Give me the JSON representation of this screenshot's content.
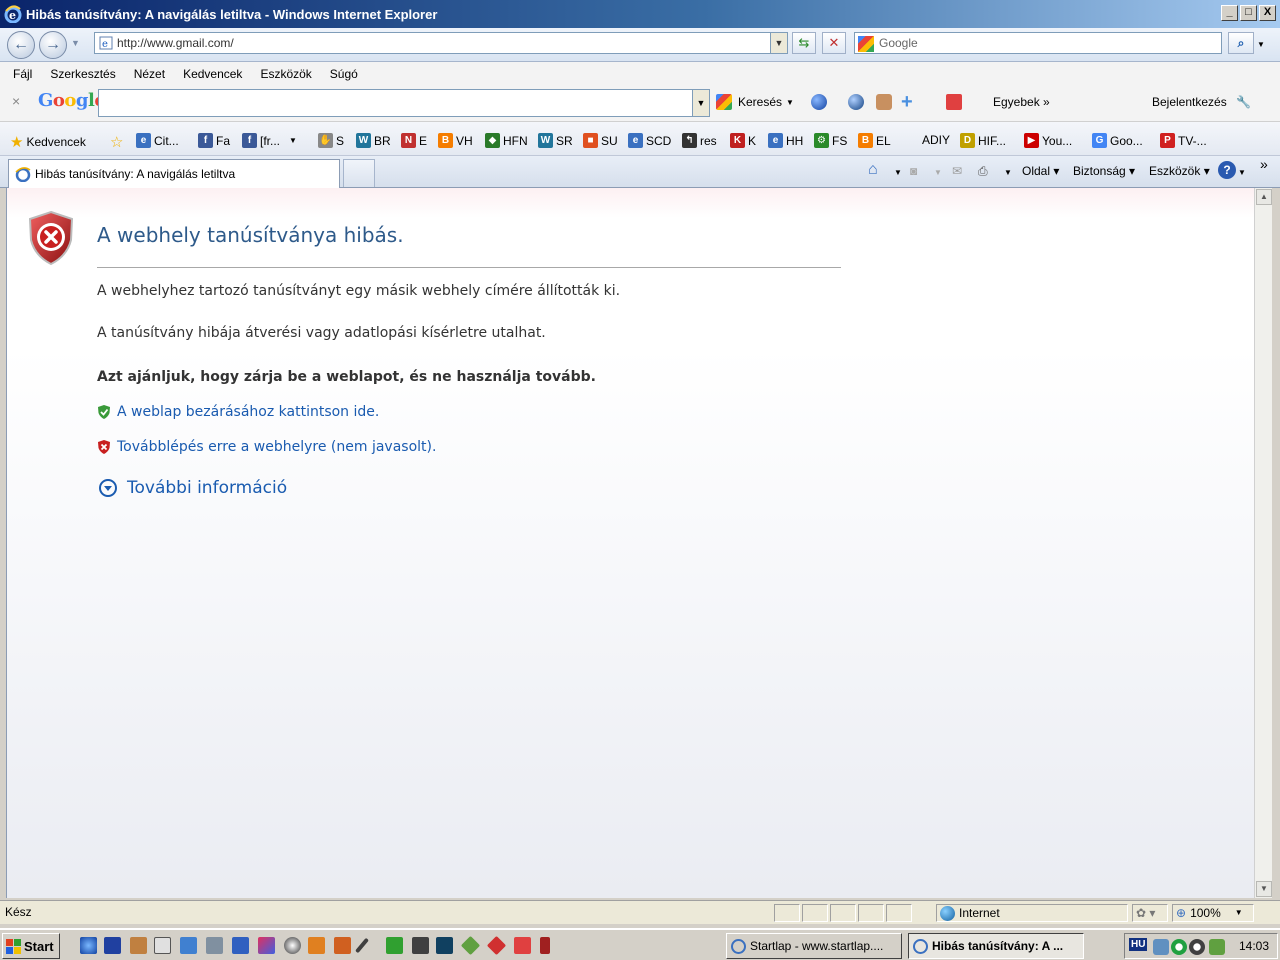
{
  "window": {
    "title": "Hibás tanúsítvány: A navigálás letiltva - Windows Internet Explorer",
    "buttons": {
      "minimize": "_",
      "maximize": "□",
      "close": "X"
    }
  },
  "navbar": {
    "address": "http://www.gmail.com/",
    "search_placeholder": "Google"
  },
  "menu": [
    "Fájl",
    "Szerkesztés",
    "Nézet",
    "Kedvencek",
    "Eszközök",
    "Súgó"
  ],
  "googlebar": {
    "logo": "Google",
    "search_label": "Keresés",
    "more_label": "Egyebek »",
    "signin_label": "Bejelentkezés"
  },
  "favorites": {
    "label": "Kedvencek",
    "items": [
      {
        "label": "Cit...",
        "icon": "ie-icon",
        "color": "#3a70c0"
      },
      {
        "label": "Fa",
        "icon": "facebook-icon",
        "color": "#3b5998"
      },
      {
        "label": "[fr...",
        "icon": "facebook-icon",
        "color": "#3b5998"
      },
      {
        "label": "S",
        "icon": "hand-icon",
        "color": "#888888"
      },
      {
        "label": "BR",
        "icon": "wordpress-icon",
        "color": "#21759b"
      },
      {
        "label": "E",
        "icon": "nks-icon",
        "color": "#c03030"
      },
      {
        "label": "VH",
        "icon": "blogger-icon",
        "color": "#f57d00"
      },
      {
        "label": "HFN",
        "icon": "shield-icon",
        "color": "#2a7a2a"
      },
      {
        "label": "SR",
        "icon": "wordpress-icon",
        "color": "#21759b"
      },
      {
        "label": "SU",
        "icon": "cube-icon",
        "color": "#e05020"
      },
      {
        "label": "SCD",
        "icon": "ie-icon",
        "color": "#3a70c0"
      },
      {
        "label": "res",
        "icon": "arrow-icon",
        "color": "#333333"
      },
      {
        "label": "K",
        "icon": "k-icon",
        "color": "#c02020"
      },
      {
        "label": "HH",
        "icon": "ie-icon",
        "color": "#3a70c0"
      },
      {
        "label": "FS",
        "icon": "gear-icon",
        "color": "#2a8a2a"
      },
      {
        "label": "EL",
        "icon": "blogger-icon",
        "color": "#f57d00"
      },
      {
        "label": "ADIY",
        "icon": "",
        "color": ""
      },
      {
        "label": "HIF...",
        "icon": "diy-icon",
        "color": "#c0a000"
      },
      {
        "label": "You...",
        "icon": "youtube-icon",
        "color": "#cc0000"
      },
      {
        "label": "Goo...",
        "icon": "google-icon",
        "color": "#4285f4"
      },
      {
        "label": "TV-...",
        "icon": "p-icon",
        "color": "#d02020"
      }
    ]
  },
  "tab": {
    "label": "Hibás tanúsítvány: A navigálás letiltva"
  },
  "commandbar": {
    "page": "Oldal",
    "safety": "Biztonság",
    "tools": "Eszközök"
  },
  "error_page": {
    "title": "A webhely tanúsítványa hibás.",
    "para1": "A webhelyhez tartozó tanúsítványt egy másik webhely címére állították ki.",
    "para2": "A tanúsítvány hibája átverési vagy adatlopási kísérletre utalhat.",
    "recommendation": "Azt ajánljuk, hogy zárja be a weblapot, és ne használja tovább.",
    "close_link": "A weblap bezárásához kattintson ide.",
    "continue_link": "Továbblépés erre a webhelyre (nem javasolt).",
    "more_info": "További információ"
  },
  "statusbar": {
    "status": "Kész",
    "zone": "Internet",
    "zoom": "100%"
  },
  "taskbar": {
    "start": "Start",
    "items": [
      {
        "label": "Startlap - www.startlap....",
        "active": false
      },
      {
        "label": "Hibás tanúsítvány: A ...",
        "active": true
      }
    ],
    "lang": "HU",
    "clock": "14:03"
  }
}
